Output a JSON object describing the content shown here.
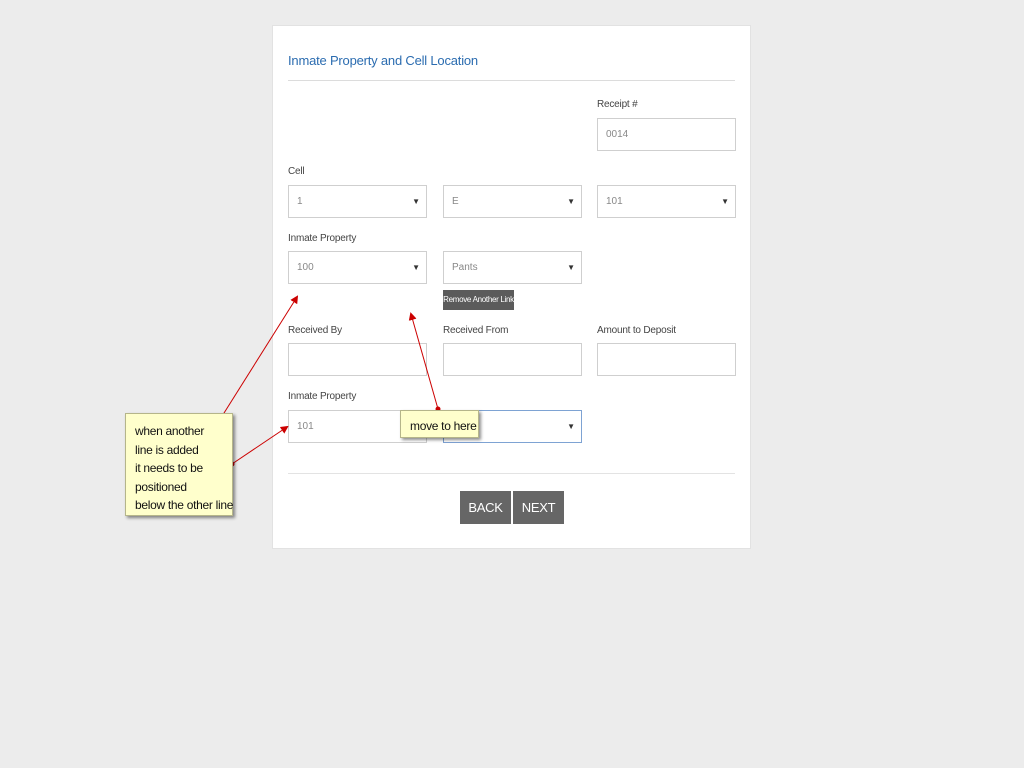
{
  "form": {
    "title": "Inmate Property and Cell Location",
    "receipt": {
      "label": "Receipt #",
      "value": "0014"
    },
    "cell": {
      "label": "Cell",
      "values": [
        "1",
        "E",
        "101"
      ]
    },
    "inmate_property_1": {
      "label": "Inmate Property",
      "number": "100",
      "item": "Pants"
    },
    "remove_link_label": "Remove Another Link",
    "received_by": {
      "label": "Received By",
      "value": ""
    },
    "received_from": {
      "label": "Received From",
      "value": ""
    },
    "amount_to_deposit": {
      "label": "Amount to Deposit",
      "value": ""
    },
    "inmate_property_2": {
      "label": "Inmate Property",
      "number": "101",
      "item": ""
    },
    "back_label": "BACK",
    "next_label": "NEXT",
    "caret": "▼"
  },
  "annotations": {
    "note1": [
      "when another",
      "line is added",
      "it needs to be",
      "positioned",
      "below the other line"
    ],
    "note2": "move to here",
    "arrow_color": "#cc0000"
  }
}
